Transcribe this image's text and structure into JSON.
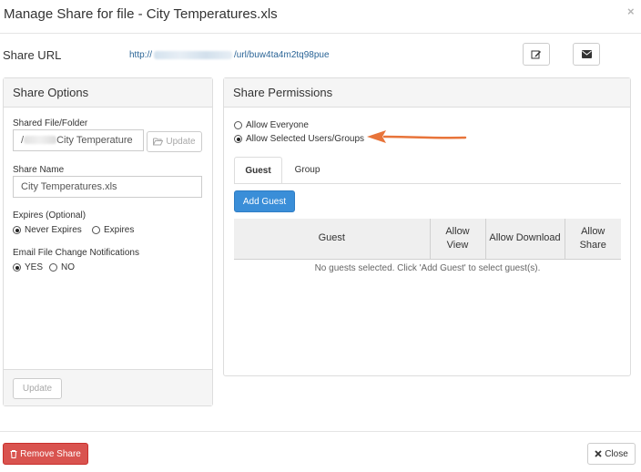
{
  "dialog": {
    "title": "Manage Share for file - City Temperatures.xls",
    "close_glyph": "×"
  },
  "share_url": {
    "label": "Share URL",
    "link_prefix": "http://",
    "link_suffix": "/url/buw4ta4m2tq98pue"
  },
  "header_buttons": {
    "edit_icon": "edit-icon",
    "email_icon": "envelope-icon"
  },
  "share_options": {
    "title": "Share Options",
    "shared_file_label": "Shared File/Folder",
    "shared_file_value_start": "/",
    "shared_file_value_end": "City Temperature",
    "update_inline_label": "Update",
    "share_name_label": "Share Name",
    "share_name_value": "City Temperatures.xls",
    "expires_label": "Expires (Optional)",
    "expires_options": [
      {
        "label": "Never Expires",
        "selected": true
      },
      {
        "label": "Expires",
        "selected": false
      }
    ],
    "notify_label": "Email File Change Notifications",
    "notify_options": [
      {
        "label": "YES",
        "selected": true
      },
      {
        "label": "NO",
        "selected": false
      }
    ],
    "footer_update_label": "Update"
  },
  "share_permissions": {
    "title": "Share Permissions",
    "options": [
      {
        "label": "Allow Everyone",
        "selected": false
      },
      {
        "label": "Allow Selected Users/Groups",
        "selected": true
      }
    ],
    "tabs": [
      {
        "label": "Guest",
        "active": true
      },
      {
        "label": "Group",
        "active": false
      }
    ],
    "add_guest_label": "Add Guest",
    "table": {
      "columns": [
        "Guest",
        "Allow View",
        "Allow Download",
        "Allow Share"
      ],
      "empty_message": "No guests selected. Click 'Add Guest' to select guest(s)."
    }
  },
  "footer": {
    "remove_label": "Remove Share",
    "close_label": "Close"
  },
  "colors": {
    "link": "#2a6496",
    "primary": "#3a8ed8",
    "danger": "#d9534f",
    "annotation_arrow": "#e8743a"
  }
}
